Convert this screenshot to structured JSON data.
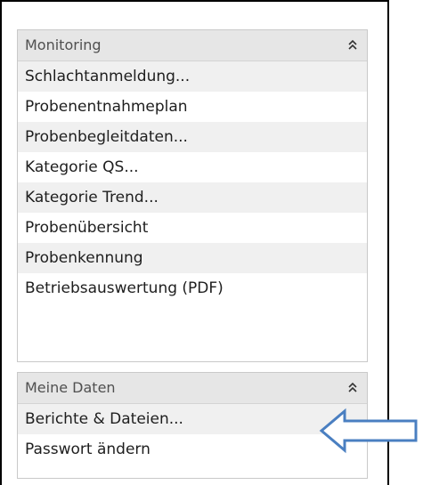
{
  "panels": {
    "monitoring": {
      "title": "Monitoring",
      "items": [
        "Schlachtanmeldung...",
        "Probenentnahmeplan",
        "Probenbegleitdaten...",
        "Kategorie QS...",
        "Kategorie Trend...",
        "Probenübersicht",
        "Probenkennung",
        "Betriebsauswertung (PDF)"
      ]
    },
    "meine_daten": {
      "title": "Meine Daten",
      "items": [
        "Berichte & Dateien...",
        "Passwort ändern"
      ]
    }
  },
  "icons": {
    "collapse": "double-chevron-up-icon",
    "annotation": "left-arrow-icon"
  },
  "colors": {
    "header_bg": "#e6e6e6",
    "row_alt_bg": "#f0f0f0",
    "arrow_stroke": "#4a7fc1"
  }
}
